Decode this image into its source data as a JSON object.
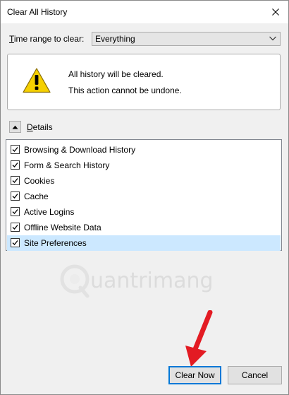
{
  "window": {
    "title": "Clear All History"
  },
  "time_range": {
    "label_prefix": "",
    "label_mnemonic": "T",
    "label_rest": "ime range to clear:",
    "selected": "Everything"
  },
  "warning": {
    "line1": "All history will be cleared.",
    "line2": "This action cannot be undone."
  },
  "details": {
    "label_mnemonic": "D",
    "label_rest": "etails",
    "expanded": true,
    "items": [
      {
        "label": "Browsing & Download History",
        "checked": true
      },
      {
        "label": "Form & Search History",
        "checked": true
      },
      {
        "label": "Cookies",
        "checked": true
      },
      {
        "label": "Cache",
        "checked": true
      },
      {
        "label": "Active Logins",
        "checked": true
      },
      {
        "label": "Offline Website Data",
        "checked": true
      },
      {
        "label": "Site Preferences",
        "checked": true,
        "selected": true
      }
    ]
  },
  "watermark": {
    "text": "uantrimang"
  },
  "buttons": {
    "clear_now": "Clear Now",
    "cancel": "Cancel"
  },
  "colors": {
    "selection": "#cce8ff",
    "focus_border": "#0078d7",
    "warning_yellow": "#f5d000",
    "annotation_arrow": "#e31b23"
  },
  "icons": {
    "close": "close-icon",
    "dropdown": "chevron-down-icon",
    "warning": "warning-icon",
    "collapse": "chevron-up-icon",
    "checkbox": "checkmark-icon",
    "annotation": "arrow-icon"
  }
}
